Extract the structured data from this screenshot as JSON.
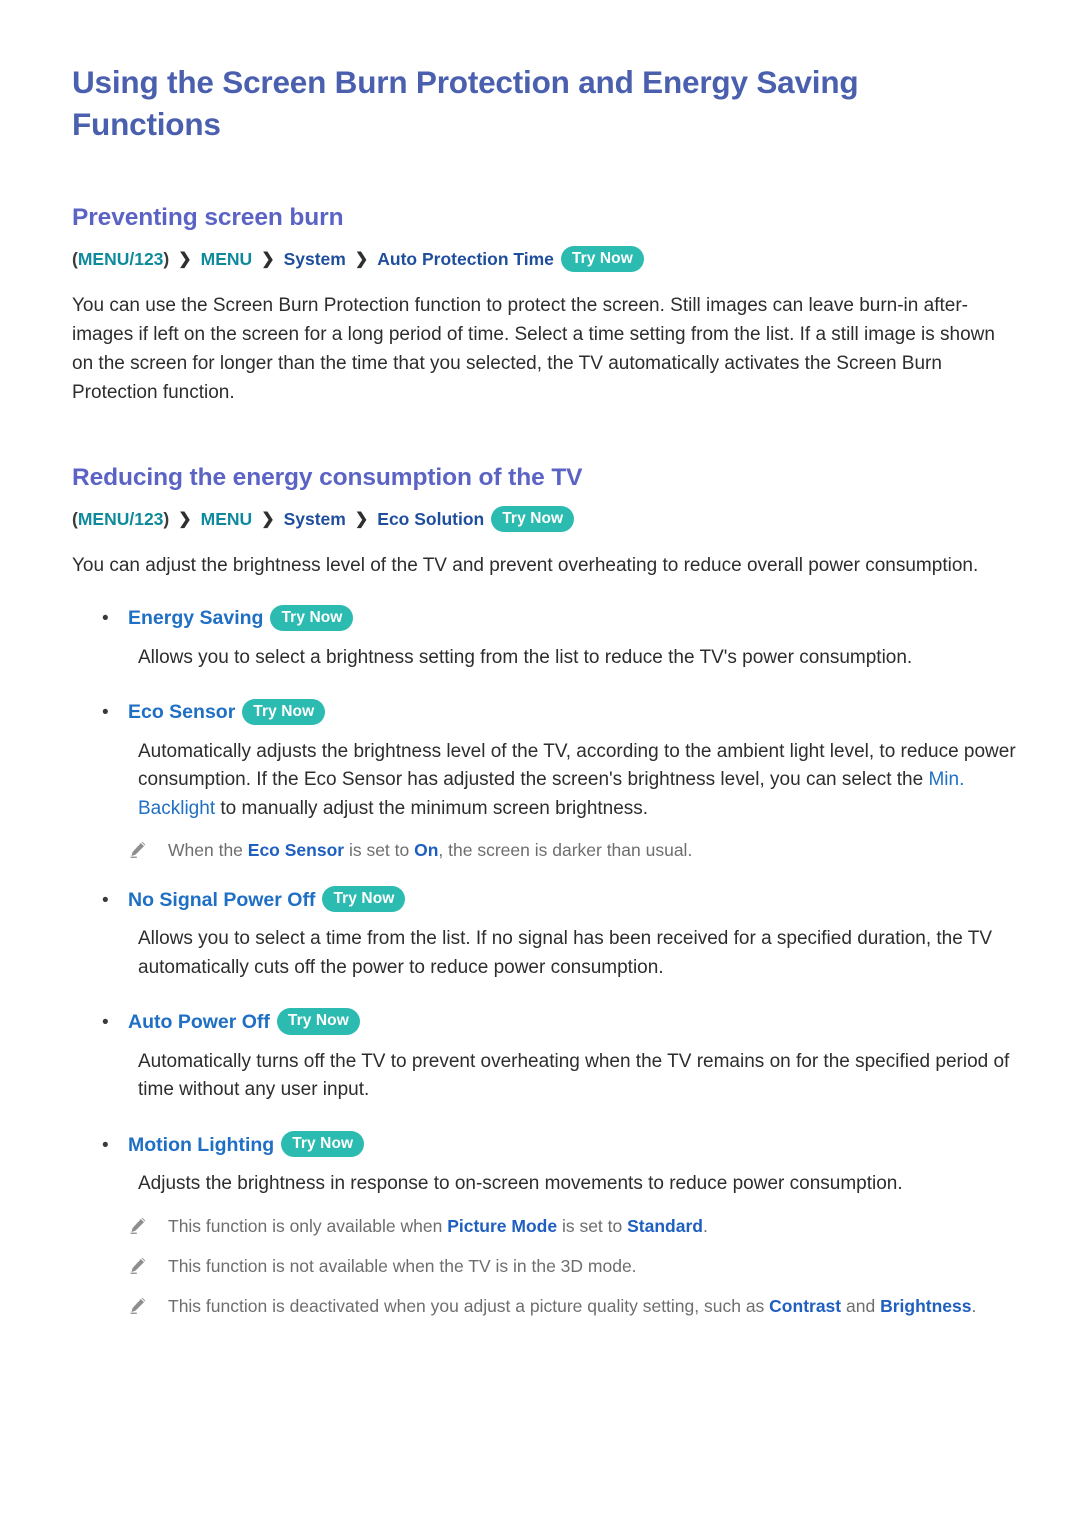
{
  "document": {
    "title": "Using the Screen Burn Protection and Energy Saving Functions"
  },
  "colors": {
    "title_blue": "#4a5fae",
    "heading_blue": "#5b63c4",
    "link_blue": "#1f6fc4",
    "key_teal": "#0e8a9c",
    "badge_teal": "#2cbbb0",
    "body_text": "#2d2d2d",
    "note_text": "#6e6e6e"
  },
  "badges": {
    "try_now": "Try Now"
  },
  "icons": {
    "note": "pencil-icon",
    "bullet": "bullet-dot-icon",
    "separator": "chevron-right-icon"
  },
  "sections": [
    {
      "heading": "Preventing screen burn",
      "menu_path": {
        "open_paren": "(",
        "key": "MENU/123",
        "close_paren": ")",
        "sep": "❯",
        "node1": "MENU",
        "node2": "System",
        "node3": "Auto Protection Time",
        "badge": "Try Now"
      },
      "paragraph": "You can use the Screen Burn Protection function to protect the screen. Still images can leave burn-in after-images if left on the screen for a long period of time. Select a time setting from the list. If a still image is shown on the screen for longer than the time that you selected, the TV automatically activates the Screen Burn Protection function."
    },
    {
      "heading": "Reducing the energy consumption of the TV",
      "menu_path": {
        "open_paren": "(",
        "key": "MENU/123",
        "close_paren": ")",
        "sep": "❯",
        "node1": "MENU",
        "node2": "System",
        "node3": "Eco Solution",
        "badge": "Try Now"
      },
      "paragraph": "You can adjust the brightness level of the TV and prevent overheating to reduce overall power consumption."
    }
  ],
  "bullets": [
    {
      "label": "Energy Saving",
      "badge": "Try Now",
      "description": "Allows you to select a brightness setting from the list to reduce the TV's power consumption."
    },
    {
      "label": "Eco Sensor",
      "badge": "Try Now",
      "desc_part1": "Automatically adjusts the brightness level of the TV, according to the ambient light level, to reduce power consumption. If the Eco Sensor has adjusted the screen's brightness level, you can select the ",
      "desc_link": "Min. Backlight",
      "desc_part2": " to manually adjust the minimum screen brightness."
    },
    {
      "label": "No Signal Power Off",
      "badge": "Try Now",
      "description": "Allows you to select a time from the list. If no signal has been received for a specified duration, the TV automatically cuts off the power to reduce power consumption."
    },
    {
      "label": "Auto Power Off",
      "badge": "Try Now",
      "description": "Automatically turns off the TV to prevent overheating when the TV remains on for the specified period of time without any user input."
    },
    {
      "label": "Motion Lighting",
      "badge": "Try Now",
      "description": "Adjusts the brightness in response to on-screen movements to reduce power consumption."
    }
  ],
  "notes": {
    "eco_sensor": {
      "part1": "When the ",
      "bold1": "Eco Sensor",
      "part2": " is set to ",
      "bold2": "On",
      "part3": ", the screen is darker than usual."
    },
    "motion_1": {
      "part1": "This function is only available when ",
      "bold1": "Picture Mode",
      "part2": " is set to ",
      "bold2": "Standard",
      "part3": "."
    },
    "motion_2": {
      "part1": "This function is not available when the TV is in the 3D mode."
    },
    "motion_3": {
      "part1": "This function is deactivated when you adjust a picture quality setting, such as ",
      "bold1": "Contrast",
      "part2": " and ",
      "bold2": "Brightness",
      "part3": "."
    }
  }
}
